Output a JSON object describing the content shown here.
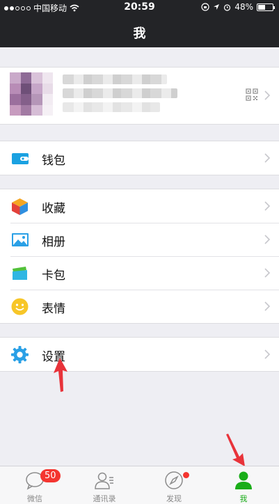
{
  "status_bar": {
    "carrier": "中国移动",
    "time": "20:59",
    "battery": "48%",
    "battery_level": 0.48
  },
  "header": {
    "title": "我"
  },
  "menu": {
    "wallet": "钱包",
    "favorites": "收藏",
    "album": "相册",
    "cards": "卡包",
    "stickers": "表情",
    "settings": "设置"
  },
  "tabbar": {
    "tabs": [
      {
        "label": "微信",
        "icon": "chat-bubble-icon",
        "badge": "50"
      },
      {
        "label": "通讯录",
        "icon": "contacts-icon"
      },
      {
        "label": "发现",
        "icon": "compass-icon"
      },
      {
        "label": "我",
        "icon": "person-icon"
      }
    ],
    "active_color": "#1aad19"
  },
  "colors": {
    "header_bg": "#232427",
    "accent_green": "#1aad19",
    "badge_red": "#f43530",
    "annotation_arrow": "#e8333a"
  }
}
